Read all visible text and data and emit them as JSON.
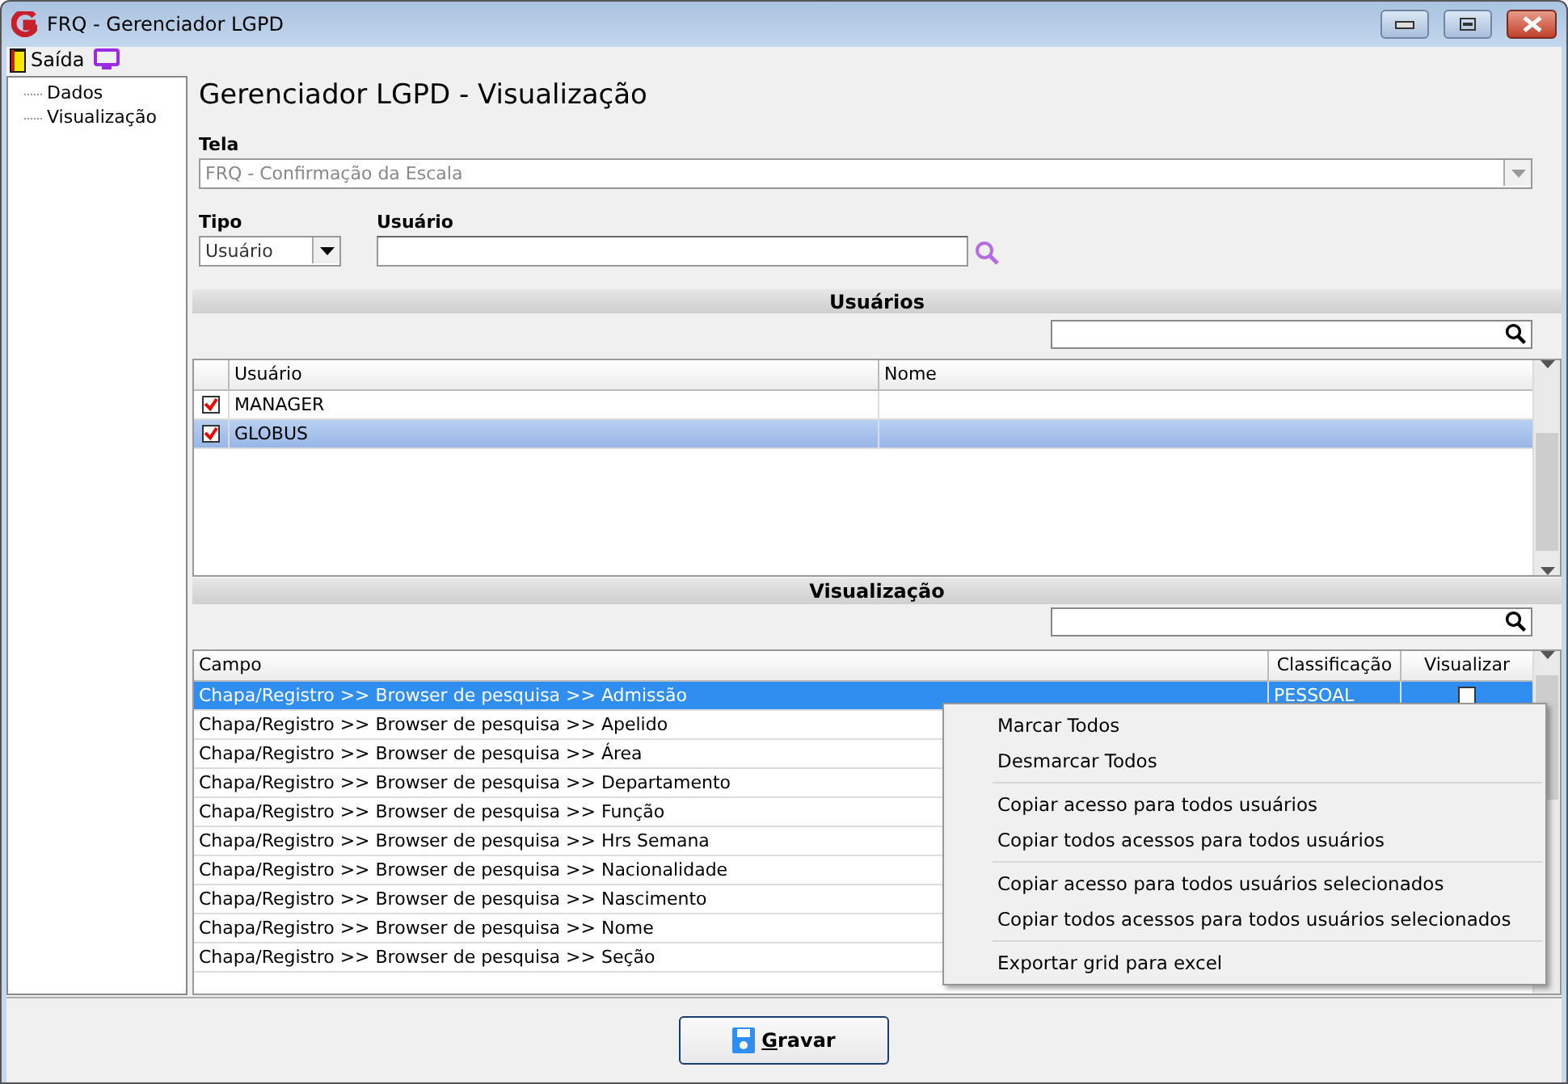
{
  "window": {
    "title": "FRQ - Gerenciador LGPD"
  },
  "toolbar": {
    "exit_label": "Saída"
  },
  "tree": {
    "items": [
      {
        "label": "Dados",
        "selected": false
      },
      {
        "label": "Visualização",
        "selected": false
      }
    ]
  },
  "heading": "Gerenciador LGPD - Visualização",
  "tela": {
    "label": "Tela",
    "value": "FRQ - Confirmação da Escala",
    "disabled": true
  },
  "tipo": {
    "label": "Tipo",
    "value": "Usuário"
  },
  "usuario": {
    "label": "Usuário"
  },
  "users_section": {
    "title": "Usuários",
    "columns": [
      "Usuário",
      "Nome"
    ],
    "rows": [
      {
        "usuario": "MANAGER",
        "checked": true,
        "selected": false
      },
      {
        "usuario": "GLOBUS",
        "checked": true,
        "selected": true
      }
    ]
  },
  "view_section": {
    "title": "Visualização",
    "columns": [
      "Campo",
      "Classificação",
      "Visualizar"
    ],
    "rows": [
      {
        "campo": "Chapa/Registro >> Browser de pesquisa >> Admissão",
        "classificacao": "PESSOAL",
        "visualizar": false,
        "selected": true
      },
      {
        "campo": "Chapa/Registro >> Browser de pesquisa >> Apelido",
        "selected": false
      },
      {
        "campo": "Chapa/Registro >> Browser de pesquisa >> Área",
        "selected": false
      },
      {
        "campo": "Chapa/Registro >> Browser de pesquisa >> Departamento",
        "selected": false
      },
      {
        "campo": "Chapa/Registro >> Browser de pesquisa >> Função",
        "selected": false
      },
      {
        "campo": "Chapa/Registro >> Browser de pesquisa >> Hrs Semana",
        "selected": false
      },
      {
        "campo": "Chapa/Registro >> Browser de pesquisa >> Nacionalidade",
        "selected": false
      },
      {
        "campo": "Chapa/Registro >> Browser de pesquisa >> Nascimento",
        "selected": false
      },
      {
        "campo": "Chapa/Registro >> Browser de pesquisa >> Nome",
        "selected": false
      },
      {
        "campo": "Chapa/Registro >> Browser de pesquisa >> Seção",
        "selected": false
      }
    ]
  },
  "context_menu": {
    "groups": [
      [
        "Marcar Todos",
        "Desmarcar Todos"
      ],
      [
        "Copiar acesso para todos usuários",
        "Copiar todos acessos para todos usuários"
      ],
      [
        "Copiar acesso para todos usuários selecionados",
        "Copiar todos acessos para todos usuários selecionados"
      ],
      [
        "Exportar grid para excel"
      ]
    ]
  },
  "save_button": {
    "label": "Gravar"
  }
}
